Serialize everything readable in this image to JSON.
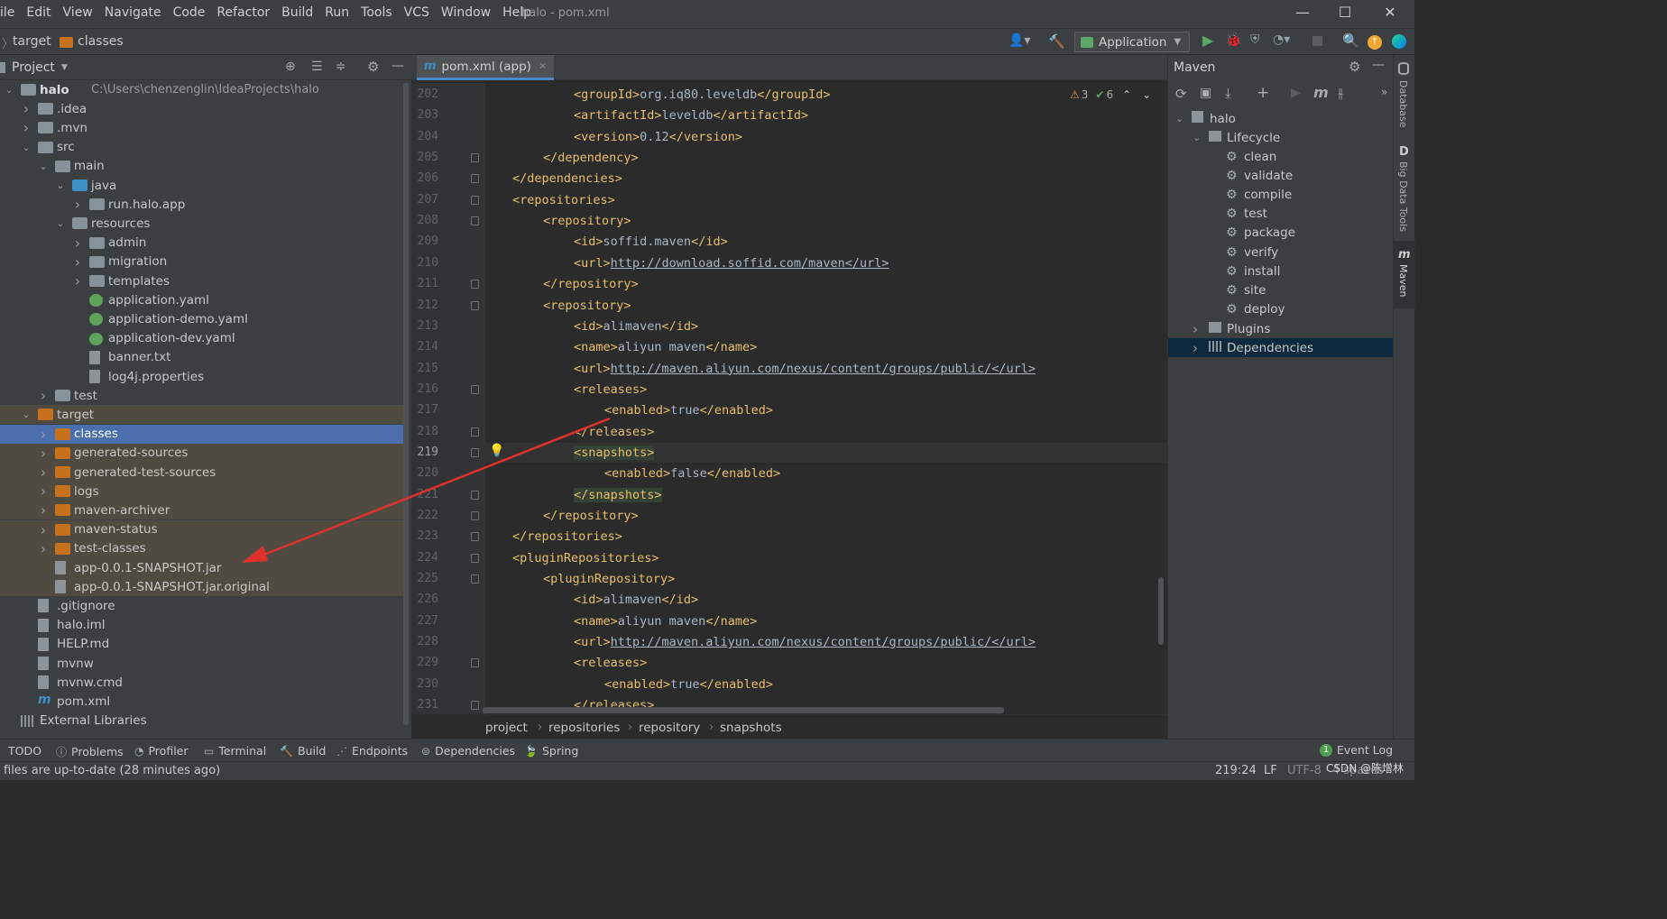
{
  "menu": [
    "ile",
    "Edit",
    "View",
    "Navigate",
    "Code",
    "Refactor",
    "Build",
    "Run",
    "Tools",
    "VCS",
    "Window",
    "Help"
  ],
  "window_title": "halo - pom.xml",
  "nav": {
    "crumb1": "target",
    "crumb2": "classes",
    "run_config": "Application"
  },
  "project_panel": {
    "title": "Project"
  },
  "tree": [
    {
      "label": "halo",
      "extra": "C:\\Users\\chenzenglin\\IdeaProjects\\halo",
      "depth": 0,
      "arrow": "open",
      "icon": "folder",
      "bold": true
    },
    {
      "label": ".idea",
      "depth": 1,
      "arrow": "closed",
      "icon": "folder"
    },
    {
      "label": ".mvn",
      "depth": 1,
      "arrow": "closed",
      "icon": "folder"
    },
    {
      "label": "src",
      "depth": 1,
      "arrow": "open",
      "icon": "folder"
    },
    {
      "label": "main",
      "depth": 2,
      "arrow": "open",
      "icon": "folder"
    },
    {
      "label": "java",
      "depth": 3,
      "arrow": "open",
      "icon": "folder-b"
    },
    {
      "label": "run.halo.app",
      "depth": 4,
      "arrow": "closed",
      "icon": "folder"
    },
    {
      "label": "resources",
      "depth": 3,
      "arrow": "open",
      "icon": "folder"
    },
    {
      "label": "admin",
      "depth": 4,
      "arrow": "closed",
      "icon": "folder"
    },
    {
      "label": "migration",
      "depth": 4,
      "arrow": "closed",
      "icon": "folder"
    },
    {
      "label": "templates",
      "depth": 4,
      "arrow": "closed",
      "icon": "folder"
    },
    {
      "label": "application.yaml",
      "depth": 4,
      "arrow": "none",
      "icon": "yaml"
    },
    {
      "label": "application-demo.yaml",
      "depth": 4,
      "arrow": "none",
      "icon": "yaml"
    },
    {
      "label": "application-dev.yaml",
      "depth": 4,
      "arrow": "none",
      "icon": "yaml"
    },
    {
      "label": "banner.txt",
      "depth": 4,
      "arrow": "none",
      "icon": "file"
    },
    {
      "label": "log4j.properties",
      "depth": 4,
      "arrow": "none",
      "icon": "file"
    },
    {
      "label": "test",
      "depth": 2,
      "arrow": "closed",
      "icon": "folder"
    },
    {
      "label": "target",
      "depth": 1,
      "arrow": "open",
      "icon": "folder-o",
      "hl": true
    },
    {
      "label": "classes",
      "depth": 2,
      "arrow": "closed",
      "icon": "folder-o",
      "sel": true
    },
    {
      "label": "generated-sources",
      "depth": 2,
      "arrow": "closed",
      "icon": "folder-o",
      "hl": true
    },
    {
      "label": "generated-test-sources",
      "depth": 2,
      "arrow": "closed",
      "icon": "folder-o",
      "hl": true
    },
    {
      "label": "logs",
      "depth": 2,
      "arrow": "closed",
      "icon": "folder-o",
      "hl": true
    },
    {
      "label": "maven-archiver",
      "depth": 2,
      "arrow": "closed",
      "icon": "folder-o",
      "hl": true
    },
    {
      "label": "maven-status",
      "depth": 2,
      "arrow": "closed",
      "icon": "folder-o",
      "hl": true
    },
    {
      "label": "test-classes",
      "depth": 2,
      "arrow": "closed",
      "icon": "folder-o",
      "hl": true
    },
    {
      "label": "app-0.0.1-SNAPSHOT.jar",
      "depth": 2,
      "arrow": "none",
      "icon": "file",
      "hl": true
    },
    {
      "label": "app-0.0.1-SNAPSHOT.jar.original",
      "depth": 2,
      "arrow": "none",
      "icon": "file",
      "hl": true
    },
    {
      "label": ".gitignore",
      "depth": 1,
      "arrow": "none",
      "icon": "file"
    },
    {
      "label": "halo.iml",
      "depth": 1,
      "arrow": "none",
      "icon": "file"
    },
    {
      "label": "HELP.md",
      "depth": 1,
      "arrow": "none",
      "icon": "file"
    },
    {
      "label": "mvnw",
      "depth": 1,
      "arrow": "none",
      "icon": "file"
    },
    {
      "label": "mvnw.cmd",
      "depth": 1,
      "arrow": "none",
      "icon": "file"
    },
    {
      "label": "pom.xml",
      "depth": 1,
      "arrow": "none",
      "icon": "maven"
    },
    {
      "label": "External Libraries",
      "depth": 0,
      "arrow": "none",
      "icon": "lib"
    }
  ],
  "editor": {
    "tab": "pom.xml (app)",
    "warnings": "3",
    "ok": "6",
    "lines": [
      {
        "n": "202",
        "indent": 4,
        "html": "<groupId>org.iq80.leveldb</groupId>"
      },
      {
        "n": "203",
        "indent": 4,
        "html": "<artifactId>leveldb</artifactId>"
      },
      {
        "n": "204",
        "indent": 4,
        "html": "<version>0.12</version>"
      },
      {
        "n": "205",
        "indent": 3,
        "html": "</dependency>"
      },
      {
        "n": "206",
        "indent": 2,
        "html": "</dependencies>"
      },
      {
        "n": "207",
        "indent": 2,
        "html": "<repositories>"
      },
      {
        "n": "208",
        "indent": 3,
        "html": "<repository>"
      },
      {
        "n": "209",
        "indent": 4,
        "html": "<id>soffid.maven</id>"
      },
      {
        "n": "210",
        "indent": 4,
        "html": "<url>http://download.soffid.com/maven</url>"
      },
      {
        "n": "211",
        "indent": 3,
        "html": "</repository>"
      },
      {
        "n": "212",
        "indent": 3,
        "html": "<repository>"
      },
      {
        "n": "213",
        "indent": 4,
        "html": "<id>alimaven</id>"
      },
      {
        "n": "214",
        "indent": 4,
        "html": "<name>aliyun maven</name>"
      },
      {
        "n": "215",
        "indent": 4,
        "html": "<url>http://maven.aliyun.com/nexus/content/groups/public/</url>"
      },
      {
        "n": "216",
        "indent": 4,
        "html": "<releases>"
      },
      {
        "n": "217",
        "indent": 5,
        "html": "<enabled>true</enabled>"
      },
      {
        "n": "218",
        "indent": 4,
        "html": "</releases>"
      },
      {
        "n": "219",
        "indent": 4,
        "html": "<snapshots>"
      },
      {
        "n": "220",
        "indent": 5,
        "html": "<enabled>false</enabled>"
      },
      {
        "n": "221",
        "indent": 4,
        "html": "</snapshots>"
      },
      {
        "n": "222",
        "indent": 3,
        "html": "</repository>"
      },
      {
        "n": "223",
        "indent": 2,
        "html": "</repositories>"
      },
      {
        "n": "224",
        "indent": 2,
        "html": "<pluginRepositories>"
      },
      {
        "n": "225",
        "indent": 3,
        "html": "<pluginRepository>"
      },
      {
        "n": "226",
        "indent": 4,
        "html": "<id>alimaven</id>"
      },
      {
        "n": "227",
        "indent": 4,
        "html": "<name>aliyun maven</name>"
      },
      {
        "n": "228",
        "indent": 4,
        "html": "<url>http://maven.aliyun.com/nexus/content/groups/public/</url>"
      },
      {
        "n": "229",
        "indent": 4,
        "html": "<releases>"
      },
      {
        "n": "230",
        "indent": 5,
        "html": "<enabled>true</enabled>"
      },
      {
        "n": "231",
        "indent": 4,
        "html": "</releases>"
      }
    ],
    "breadcrumbs": [
      "project",
      "repositories",
      "repository",
      "snapshots"
    ]
  },
  "maven": {
    "title": "Maven",
    "root": "halo",
    "lifecycle": "Lifecycle",
    "goals": [
      "clean",
      "validate",
      "compile",
      "test",
      "package",
      "verify",
      "install",
      "site",
      "deploy"
    ],
    "plugins": "Plugins",
    "dependencies": "Dependencies"
  },
  "right_strip": [
    "Database",
    "Big Data Tools",
    "Maven"
  ],
  "toolwindows": [
    "TODO",
    "Problems",
    "Profiler",
    "Terminal",
    "Build",
    "Endpoints",
    "Dependencies",
    "Spring"
  ],
  "event_log": {
    "count": "1",
    "label": "Event Log"
  },
  "status": {
    "message": "files are up-to-date (28 minutes ago)",
    "position": "219:24",
    "line_sep": "LF",
    "encoding": "UTF-8",
    "indent": "4 spaces",
    "watermark": "CSDN @陈增林"
  }
}
